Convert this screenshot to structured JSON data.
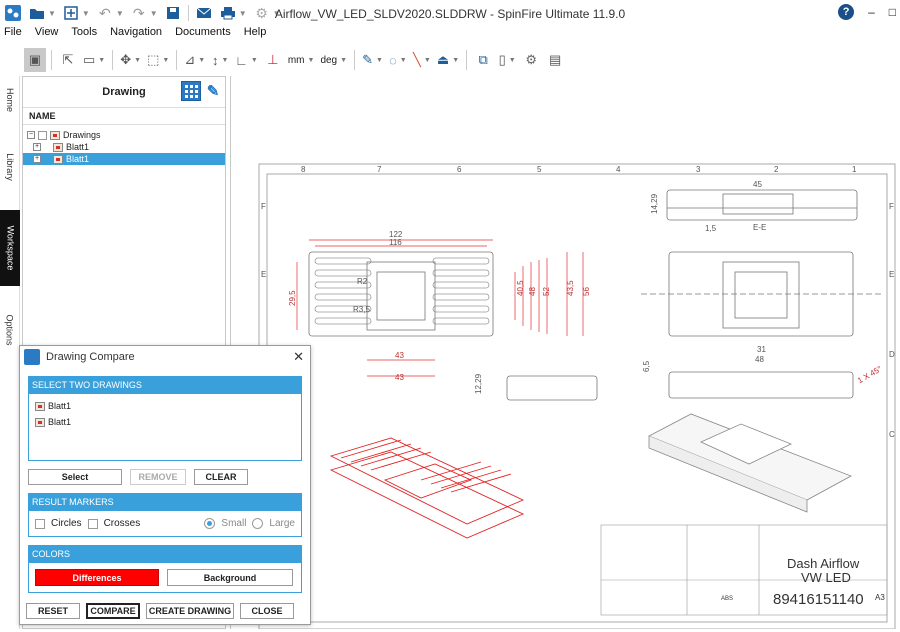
{
  "window": {
    "title": "Airflow_VW_LED_SLDV2020.SLDDRW - SpinFire Ultimate 11.9.0"
  },
  "menu": [
    "File",
    "View",
    "Tools",
    "Navigation",
    "Documents",
    "Help"
  ],
  "toolbar": {
    "units_length": "mm",
    "units_angle": "deg"
  },
  "side_tabs": [
    "Home",
    "Library",
    "Workspace",
    "Options"
  ],
  "left_panel": {
    "title": "Drawing",
    "column_name": "NAME",
    "tree": [
      {
        "label": "Drawings",
        "selected": false
      },
      {
        "label": "Blatt1",
        "selected": false
      },
      {
        "label": "Blatt1",
        "selected": true
      }
    ]
  },
  "drawing": {
    "border_letters": [
      "F",
      "E",
      "D",
      "C"
    ],
    "border_numbers": [
      "8",
      "7",
      "6",
      "5",
      "4",
      "3",
      "2",
      "1"
    ],
    "dims": {
      "d122": "122",
      "d116": "116",
      "d29_5": "29,5",
      "d43a": "43",
      "d43b": "43",
      "d40_5": "40,5",
      "d48": "48",
      "d52": "52",
      "d43_5": "43,5",
      "d56": "56",
      "d45": "45",
      "d14_29": "14,29",
      "d12_29": "12,29",
      "d31": "31",
      "d48b": "48",
      "d6_5": "6,5",
      "d1_5": "1,5",
      "ee": "E-E",
      "chamfer": "1 X 45°",
      "r3_5": "R3,5",
      "r2": "R2"
    },
    "title_block": {
      "name1": "Dash Airflow",
      "name2": "VW LED",
      "number": "89416151140",
      "size": "A3",
      "material": "ABS"
    }
  },
  "dialog": {
    "title": "Drawing Compare",
    "section_select": "SELECT TWO DRAWINGS",
    "list": [
      "Blatt1",
      "Blatt1"
    ],
    "btn_select": "Select",
    "btn_remove": "REMOVE",
    "btn_clear": "CLEAR",
    "section_markers": "RESULT MARKERS",
    "opt_circles": "Circles",
    "opt_crosses": "Crosses",
    "opt_small": "Small",
    "opt_large": "Large",
    "section_colors": "COLORS",
    "btn_differences": "Differences",
    "btn_background": "Background",
    "btn_reset": "RESET",
    "btn_compare": "COMPARE",
    "btn_create": "CREATE DRAWING",
    "btn_close": "CLOSE",
    "colors": {
      "accent": "#3aa0dc",
      "differences": "#ff0000"
    }
  }
}
